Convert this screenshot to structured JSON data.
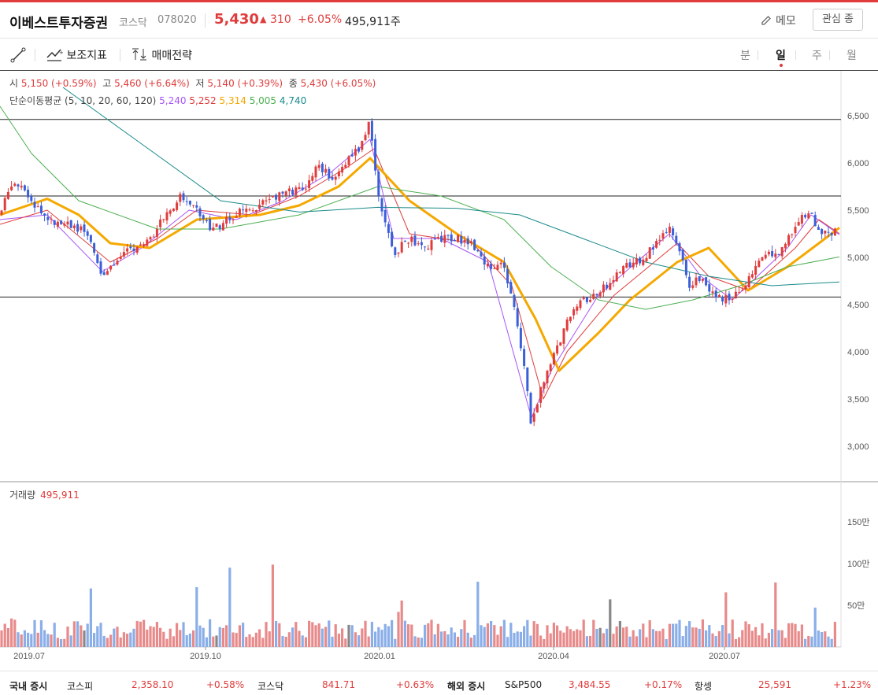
{
  "header": {
    "name": "이베스트투자증권",
    "market": "코스닥",
    "code": "078020",
    "price": "5,430",
    "change": "310",
    "change_rate": "+6.05%",
    "volume": "495,911주",
    "memo_label": "메모",
    "favorite_label": "관심 종"
  },
  "toolbar": {
    "indicator_label": "보조지표",
    "strategy_label": "매매전략",
    "periods": [
      "분",
      "일",
      "주",
      "월"
    ],
    "active_period": "일"
  },
  "ohlc": {
    "open_label": "시",
    "open": "5,150 (+0.59%)",
    "high_label": "고",
    "high": "5,460 (+6.64%)",
    "low_label": "저",
    "low": "5,140 (+0.39%)",
    "close_label": "종",
    "close": "5,430 (+6.05%)"
  },
  "moving_average": {
    "label": "단순이동평균 (5, 10, 20, 60, 120)",
    "values": [
      "5,240",
      "5,252",
      "5,314",
      "5,005",
      "4,740"
    ],
    "colors": [
      "#a855f7",
      "#e03c3c",
      "#f5a800",
      "#4caf50",
      "#1a8a8a"
    ]
  },
  "volume_panel": {
    "label": "거래량",
    "value": "495,911"
  },
  "colors": {
    "up": "#e03c3c",
    "down": "#3b5fd9",
    "up_vol": "#e88a8a",
    "down_vol": "#8aaee8",
    "flat_vol": "#888888"
  },
  "chart_data": {
    "type": "candlestick",
    "y_ticks": [
      "6,500",
      "6,000",
      "5,500",
      "5,000",
      "4,500",
      "4,000",
      "3,500",
      "3,000"
    ],
    "ylim": [
      2600,
      6800
    ],
    "x_ticks": [
      "2019.07",
      "2019.10",
      "2020.01",
      "2020.04",
      "2020.07"
    ],
    "volume_ticks": [
      "150만",
      "100만",
      "50만"
    ],
    "horizontal_lines": [
      6460,
      5650,
      4580
    ],
    "price_path": [
      [
        0,
        5450
      ],
      [
        15,
        5800
      ],
      [
        30,
        5700
      ],
      [
        60,
        5400
      ],
      [
        90,
        5350
      ],
      [
        110,
        5250
      ],
      [
        130,
        4800
      ],
      [
        150,
        5000
      ],
      [
        170,
        5100
      ],
      [
        190,
        5200
      ],
      [
        210,
        5450
      ],
      [
        230,
        5650
      ],
      [
        250,
        5500
      ],
      [
        270,
        5300
      ],
      [
        290,
        5400
      ],
      [
        310,
        5500
      ],
      [
        330,
        5550
      ],
      [
        350,
        5650
      ],
      [
        370,
        5700
      ],
      [
        390,
        5700
      ],
      [
        400,
        6000
      ],
      [
        420,
        5850
      ],
      [
        440,
        6000
      ],
      [
        460,
        6200
      ],
      [
        470,
        6450
      ],
      [
        480,
        5700
      ],
      [
        490,
        5300
      ],
      [
        500,
        5050
      ],
      [
        520,
        5200
      ],
      [
        540,
        5100
      ],
      [
        560,
        5200
      ],
      [
        580,
        5200
      ],
      [
        600,
        5150
      ],
      [
        620,
        4900
      ],
      [
        640,
        4900
      ],
      [
        655,
        4400
      ],
      [
        665,
        3900
      ],
      [
        675,
        3200
      ],
      [
        690,
        3700
      ],
      [
        700,
        3900
      ],
      [
        715,
        4200
      ],
      [
        730,
        4500
      ],
      [
        750,
        4550
      ],
      [
        770,
        4700
      ],
      [
        790,
        4900
      ],
      [
        810,
        4950
      ],
      [
        830,
        5100
      ],
      [
        850,
        5300
      ],
      [
        865,
        5000
      ],
      [
        875,
        4700
      ],
      [
        890,
        4800
      ],
      [
        905,
        4600
      ],
      [
        920,
        4550
      ],
      [
        940,
        4650
      ],
      [
        955,
        4800
      ],
      [
        970,
        5050
      ],
      [
        990,
        5050
      ],
      [
        1010,
        5300
      ],
      [
        1025,
        5500
      ],
      [
        1040,
        5300
      ],
      [
        1055,
        5200
      ],
      [
        1066,
        5430
      ]
    ],
    "ma_paths": [
      {
        "name": "5",
        "color": "#a855f7",
        "points": [
          [
            0,
            5400
          ],
          [
            60,
            5450
          ],
          [
            130,
            4850
          ],
          [
            180,
            5100
          ],
          [
            240,
            5500
          ],
          [
            300,
            5400
          ],
          [
            360,
            5600
          ],
          [
            420,
            5900
          ],
          [
            470,
            6250
          ],
          [
            500,
            5200
          ],
          [
            560,
            5200
          ],
          [
            620,
            4950
          ],
          [
            675,
            3300
          ],
          [
            700,
            3800
          ],
          [
            760,
            4600
          ],
          [
            850,
            5250
          ],
          [
            890,
            4800
          ],
          [
            930,
            4550
          ],
          [
            1000,
            5100
          ],
          [
            1030,
            5450
          ],
          [
            1066,
            5240
          ]
        ]
      },
      {
        "name": "10",
        "color": "#e03c3c",
        "points": [
          [
            0,
            5350
          ],
          [
            60,
            5500
          ],
          [
            140,
            4950
          ],
          [
            200,
            5200
          ],
          [
            250,
            5500
          ],
          [
            320,
            5450
          ],
          [
            380,
            5650
          ],
          [
            440,
            5950
          ],
          [
            475,
            6150
          ],
          [
            520,
            5250
          ],
          [
            600,
            5150
          ],
          [
            650,
            4700
          ],
          [
            690,
            3500
          ],
          [
            720,
            4000
          ],
          [
            780,
            4600
          ],
          [
            860,
            5150
          ],
          [
            900,
            4800
          ],
          [
            950,
            4650
          ],
          [
            1010,
            5100
          ],
          [
            1040,
            5400
          ],
          [
            1066,
            5252
          ]
        ]
      },
      {
        "name": "20",
        "color": "#f5a800",
        "points": [
          [
            0,
            5450
          ],
          [
            60,
            5620
          ],
          [
            100,
            5450
          ],
          [
            140,
            5150
          ],
          [
            190,
            5100
          ],
          [
            250,
            5400
          ],
          [
            330,
            5450
          ],
          [
            380,
            5550
          ],
          [
            430,
            5750
          ],
          [
            470,
            6050
          ],
          [
            520,
            5600
          ],
          [
            580,
            5250
          ],
          [
            640,
            4950
          ],
          [
            680,
            4350
          ],
          [
            710,
            3800
          ],
          [
            760,
            4200
          ],
          [
            800,
            4550
          ],
          [
            860,
            4950
          ],
          [
            900,
            5100
          ],
          [
            950,
            4650
          ],
          [
            1000,
            4900
          ],
          [
            1040,
            5150
          ],
          [
            1066,
            5314
          ]
        ]
      },
      {
        "name": "60",
        "color": "#4caf50",
        "points": [
          [
            0,
            6600
          ],
          [
            40,
            6100
          ],
          [
            100,
            5600
          ],
          [
            200,
            5300
          ],
          [
            280,
            5300
          ],
          [
            380,
            5450
          ],
          [
            480,
            5750
          ],
          [
            560,
            5650
          ],
          [
            640,
            5400
          ],
          [
            700,
            4900
          ],
          [
            760,
            4550
          ],
          [
            820,
            4450
          ],
          [
            880,
            4550
          ],
          [
            940,
            4700
          ],
          [
            1000,
            4900
          ],
          [
            1066,
            5005
          ]
        ]
      },
      {
        "name": "120",
        "color": "#1a8a8a",
        "points": [
          [
            80,
            6800
          ],
          [
            180,
            6200
          ],
          [
            280,
            5600
          ],
          [
            380,
            5480
          ],
          [
            480,
            5530
          ],
          [
            580,
            5520
          ],
          [
            660,
            5450
          ],
          [
            740,
            5200
          ],
          [
            820,
            4950
          ],
          [
            900,
            4800
          ],
          [
            980,
            4700
          ],
          [
            1066,
            4740
          ]
        ]
      }
    ]
  },
  "footer": {
    "domestic_label": "국내 증시",
    "kospi_label": "코스피",
    "kospi": "2,358.10",
    "kospi_pct": "+0.58%",
    "kosdaq_label": "코스닥",
    "kosdaq": "841.71",
    "kosdaq_pct": "+0.63%",
    "overseas_label": "해외 증시",
    "sp_label": "S&P500",
    "sp": "3,484.55",
    "sp_pct": "+0.17%",
    "hs_label": "항셍",
    "hs": "25,591",
    "hs_pct": "+1.23%"
  }
}
